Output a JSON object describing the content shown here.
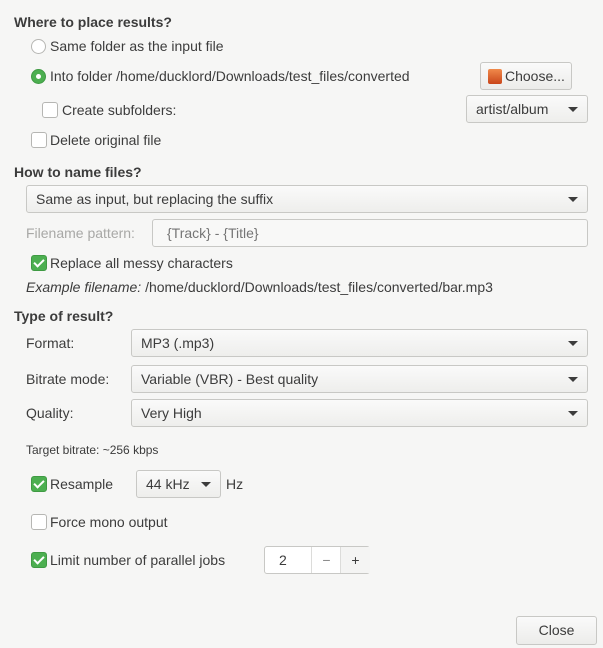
{
  "placement": {
    "heading": "Where to place results?",
    "same_folder": "Same folder as the input file",
    "into_folder": "Into folder /home/ducklord/Downloads/test_files/converted",
    "choose": "Choose...",
    "create_subfolders": "Create subfolders:",
    "subfolder_pattern": "artist/album",
    "delete_original": "Delete original file"
  },
  "naming": {
    "heading": "How to name files?",
    "mode": "Same as input, but replacing the suffix",
    "pattern_label": "Filename pattern:",
    "pattern_placeholder": "{Track} - {Title}",
    "replace_messy": "Replace all messy characters",
    "example_label": "Example filename:",
    "example_value": "/home/ducklord/Downloads/test_files/converted/bar.mp3"
  },
  "result": {
    "heading": "Type of result?",
    "format_label": "Format:",
    "format": "MP3 (.mp3)",
    "bitrate_mode_label": "Bitrate mode:",
    "bitrate_mode": "Variable (VBR) - Best quality",
    "quality_label": "Quality:",
    "quality": "Very High",
    "target_bitrate": "Target bitrate: ~256 kbps",
    "resample": "Resample",
    "resample_rate": "44 kHz",
    "hz": "Hz",
    "force_mono": "Force mono output",
    "limit_jobs": "Limit number of parallel jobs",
    "jobs": "2",
    "minus": "−",
    "plus": "+"
  },
  "close": "Close",
  "colors": {
    "accent": "#4caf50"
  }
}
